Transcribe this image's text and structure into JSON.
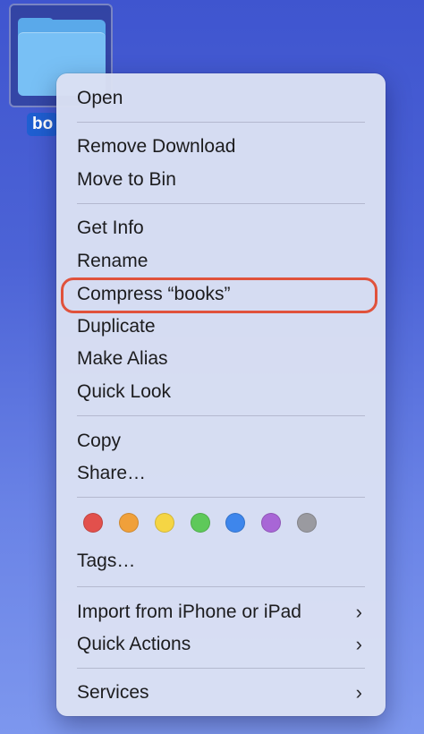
{
  "desktop": {
    "folder_label": "bo"
  },
  "menu": {
    "open": "Open",
    "remove_download": "Remove Download",
    "move_to_bin": "Move to Bin",
    "get_info": "Get Info",
    "rename": "Rename",
    "compress": "Compress “books”",
    "duplicate": "Duplicate",
    "make_alias": "Make Alias",
    "quick_look": "Quick Look",
    "copy": "Copy",
    "share": "Share…",
    "tags": "Tags…",
    "import_from_iphone": "Import from iPhone or iPad",
    "quick_actions": "Quick Actions",
    "services": "Services",
    "submenu_chevron": "›"
  },
  "tag_colors": {
    "red": "#e2504c",
    "orange": "#f0a03a",
    "yellow": "#f5d544",
    "green": "#5ec95a",
    "blue": "#3e86ec",
    "purple": "#a866d6",
    "gray": "#9a9aa0"
  },
  "annotation": {
    "highlight_color": "#e0523c"
  }
}
